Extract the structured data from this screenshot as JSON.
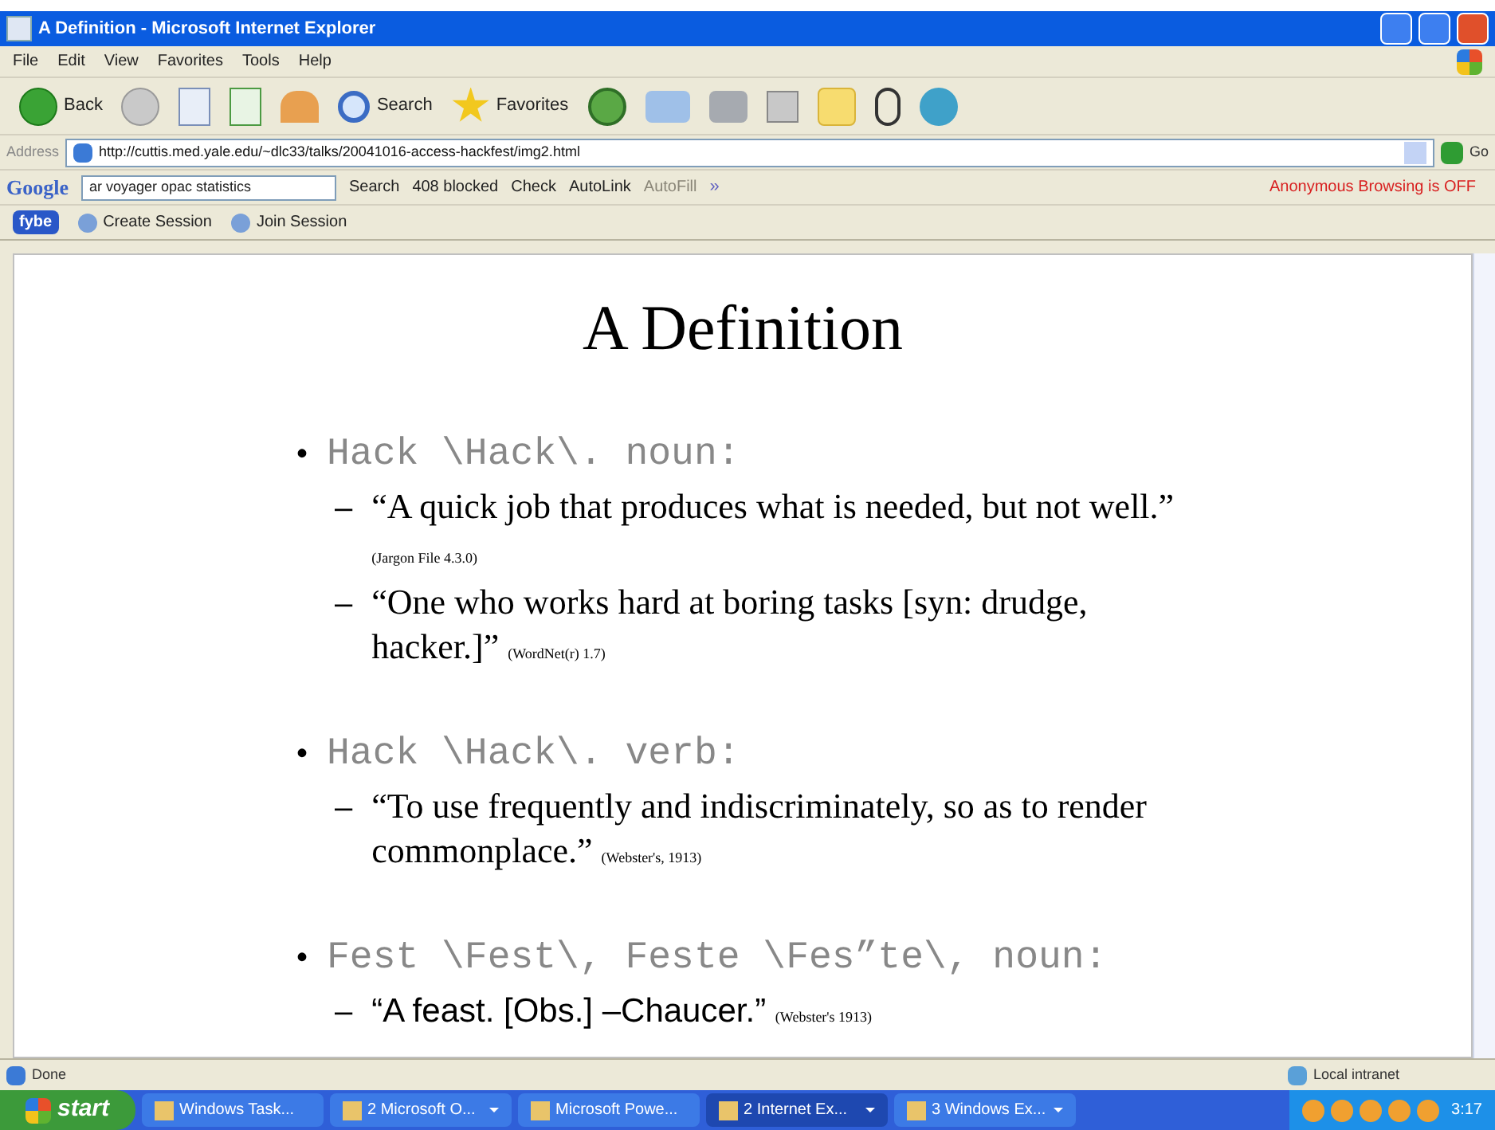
{
  "window": {
    "title": "A Definition - Microsoft Internet Explorer"
  },
  "menu": [
    "File",
    "Edit",
    "View",
    "Favorites",
    "Tools",
    "Help"
  ],
  "toolbar": [
    {
      "kind": "back",
      "label": "Back"
    },
    {
      "kind": "forward"
    },
    {
      "kind": "stop"
    },
    {
      "kind": "refresh"
    },
    {
      "kind": "home"
    },
    {
      "kind": "search",
      "label": "Search"
    },
    {
      "kind": "favorites",
      "label": "Favorites"
    },
    {
      "kind": "history"
    },
    {
      "kind": "mail"
    },
    {
      "kind": "print"
    },
    {
      "kind": "edit"
    },
    {
      "kind": "note"
    },
    {
      "kind": "messenger-figure"
    },
    {
      "kind": "messenger-people"
    }
  ],
  "address": {
    "label": "Address",
    "value": "http://cuttis.med.yale.edu/~dlc33/talks/20041016-access-hackfest/img2.html",
    "go": "Go"
  },
  "google_bar": {
    "logo": "Google",
    "query": "ar voyager opac statistics",
    "search": "Search",
    "blocked": "408 blocked",
    "check": "Check",
    "autolink": "AutoLink",
    "autofill": "AutoFill",
    "more": "»",
    "anonymous": "Anonymous Browsing is OFF"
  },
  "session_bar": {
    "logo": "fybe",
    "items": [
      "Create Session",
      "Join Session"
    ]
  },
  "slide": {
    "title": "A Definition",
    "entries": [
      {
        "bullet": "•",
        "term": "Hack \\Hack\\. noun:",
        "definitions": [
          {
            "dash": "–",
            "text": "“A quick job that produces what is needed, but not well.”",
            "source": "(Jargon File 4.3.0)",
            "kind": "serif"
          },
          {
            "dash": "–",
            "text": "“One who works hard at boring tasks [syn: drudge, hacker.]”",
            "source": "(WordNet(r) 1.7)",
            "kind": "serif"
          }
        ]
      },
      {
        "bullet": "•",
        "term": "Hack \\Hack\\. verb:",
        "definitions": [
          {
            "dash": "–",
            "text": "“To use frequently and indiscriminately, so as to render commonplace.”",
            "source": "(Webster's, 1913)",
            "kind": "serif"
          }
        ]
      },
      {
        "bullet": "•",
        "term": "Fest \\Fest\\, Feste \\Fes”te\\, noun:",
        "definitions": [
          {
            "dash": "–",
            "text": "“A feast. [Obs.]  –Chaucer.”",
            "source": "(Webster's 1913)",
            "kind": "sans"
          }
        ]
      }
    ]
  },
  "status_bar": {
    "status": "Done",
    "zone": "Local intranet"
  },
  "taskbar": {
    "start": "start",
    "tasks": [
      {
        "label": "Windows Task...",
        "selected": false,
        "menu": false
      },
      {
        "label": "2 Microsoft O...",
        "selected": false,
        "menu": true
      },
      {
        "label": "Microsoft Powe...",
        "selected": false,
        "menu": false
      },
      {
        "label": "2 Internet Ex...",
        "selected": true,
        "menu": true
      },
      {
        "label": "3 Windows Ex...",
        "selected": false,
        "menu": true
      }
    ],
    "time": "3:17"
  }
}
